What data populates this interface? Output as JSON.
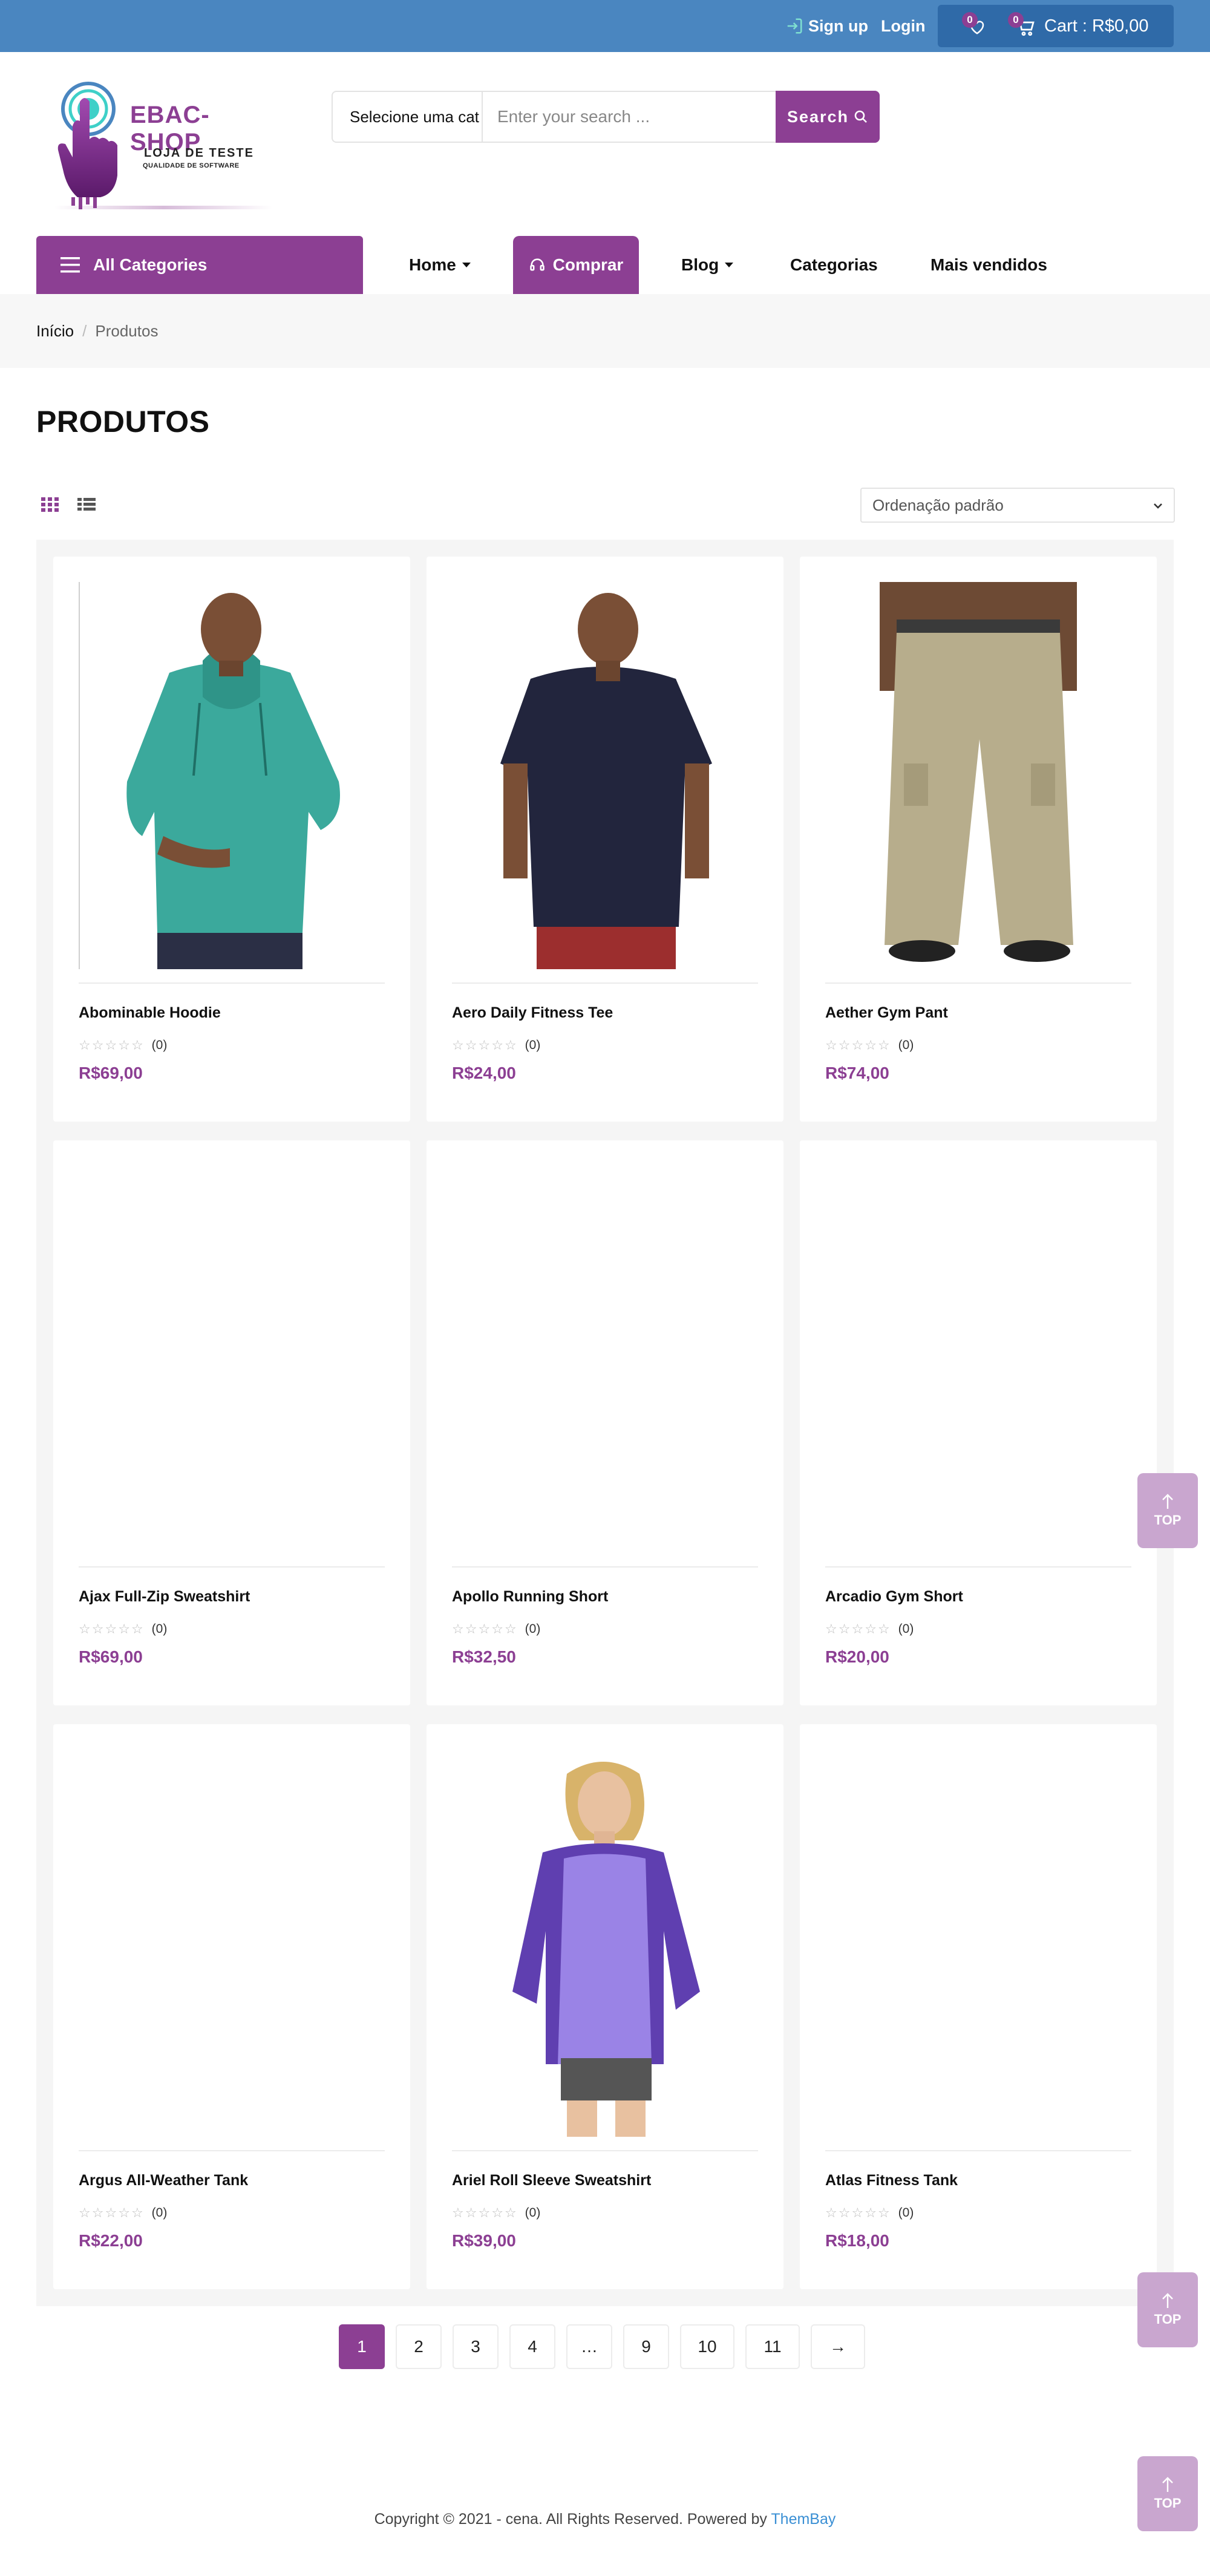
{
  "topbar": {
    "signup_label": "Sign up",
    "login_label": "Login",
    "wishlist_count": "0",
    "cart_count": "0",
    "cart_label": "Cart : R$0,00"
  },
  "logo": {
    "brand": "EBAC-SHOP",
    "tagline": "LOJA DE TESTE",
    "tagline_small": "QUALIDADE DE SOFTWARE"
  },
  "search": {
    "category": "Selecione uma cat",
    "placeholder": "Enter your search ...",
    "button_label": "Search"
  },
  "nav": {
    "all_categories": "All Categories",
    "home": "Home",
    "comprar": "Comprar",
    "blog": "Blog",
    "categorias": "Categorias",
    "mais_vendidos": "Mais vendidos"
  },
  "breadcrumb": {
    "home": "Início",
    "separator": "/",
    "current": "Produtos"
  },
  "page_title": "PRODUTOS",
  "sort": {
    "selected": "Ordenação padrão"
  },
  "products": [
    {
      "name": "Abominable Hoodie",
      "reviews": "(0)",
      "price": "R$69,00",
      "image": "man-teal-hoodie"
    },
    {
      "name": "Aero Daily Fitness Tee",
      "reviews": "(0)",
      "price": "R$24,00",
      "image": "man-navy-tee"
    },
    {
      "name": "Aether Gym Pant",
      "reviews": "(0)",
      "price": "R$74,00",
      "image": "khaki-pants"
    },
    {
      "name": "Ajax Full-Zip Sweatshirt",
      "reviews": "(0)",
      "price": "R$69,00",
      "image": "none"
    },
    {
      "name": "Apollo Running Short",
      "reviews": "(0)",
      "price": "R$32,50",
      "image": "none"
    },
    {
      "name": "Arcadio Gym Short",
      "reviews": "(0)",
      "price": "R$20,00",
      "image": "none"
    },
    {
      "name": "Argus All-Weather Tank",
      "reviews": "(0)",
      "price": "R$22,00",
      "image": "none"
    },
    {
      "name": "Ariel Roll Sleeve Sweatshirt",
      "reviews": "(0)",
      "price": "R$39,00",
      "image": "woman-purple-sweatshirt"
    },
    {
      "name": "Atlas Fitness Tank",
      "reviews": "(0)",
      "price": "R$18,00",
      "image": "none"
    }
  ],
  "pagination": [
    "1",
    "2",
    "3",
    "4",
    "…",
    "9",
    "10",
    "11",
    "→"
  ],
  "pagination_active": "1",
  "top_button_label": "TOP",
  "footer": {
    "text": "Copyright © 2021 - cena. All Rights Reserved. Powered by",
    "link": "ThemBay"
  },
  "colors": {
    "topbar": "#4a86c0",
    "accent": "#8c3f93",
    "top_button": "#c9a6cf"
  }
}
